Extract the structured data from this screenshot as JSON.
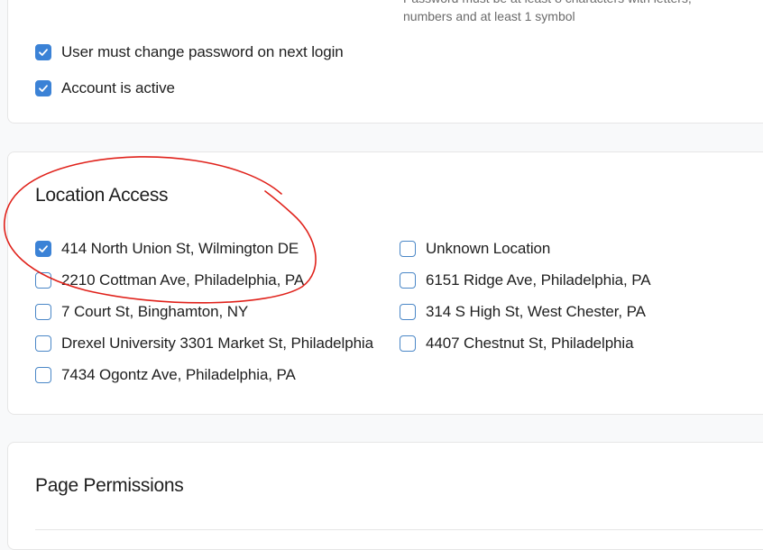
{
  "password_section": {
    "hint_line1": "Password must be at least 8 characters with letters,",
    "hint_line2": "numbers and at least 1 symbol",
    "options": [
      {
        "label": "User must change password on next login",
        "checked": true
      },
      {
        "label": "Account is active",
        "checked": true
      }
    ]
  },
  "location_access": {
    "title": "Location Access",
    "locations": [
      {
        "label": "414 North Union St, Wilmington DE",
        "checked": true
      },
      {
        "label": "Unknown Location",
        "checked": false
      },
      {
        "label": "2210 Cottman Ave, Philadelphia, PA",
        "checked": false
      },
      {
        "label": "6151 Ridge Ave, Philadelphia, PA",
        "checked": false
      },
      {
        "label": "7 Court St, Binghamton, NY",
        "checked": false
      },
      {
        "label": "314 S High St, West Chester, PA",
        "checked": false
      },
      {
        "label": "Drexel University 3301 Market St, Philadelphia",
        "checked": false
      },
      {
        "label": "4407 Chestnut St, Philadelphia",
        "checked": false
      },
      {
        "label": "7434 Ogontz Ave, Philadelphia, PA",
        "checked": false
      }
    ]
  },
  "page_permissions": {
    "title": "Page Permissions"
  },
  "colors": {
    "checkbox_accent": "#3b82d6",
    "annotation": "#e0221b"
  }
}
